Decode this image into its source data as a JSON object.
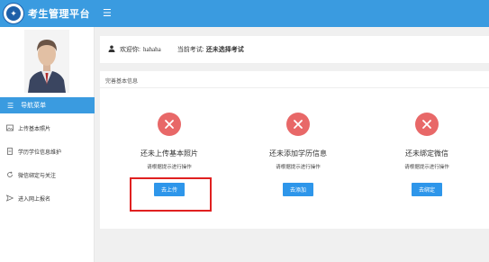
{
  "app": {
    "title": "考生管理平台",
    "logo_icon": "university-seal-icon"
  },
  "colors": {
    "primary": "#3a9be0",
    "button": "#2e96ea",
    "error": "#e86868",
    "highlight": "#e02020"
  },
  "sidebar": {
    "nav_header": "导航菜单",
    "items": [
      {
        "label": "上传基本照片",
        "icon": "image-icon"
      },
      {
        "label": "学历学位信息维护",
        "icon": "document-icon"
      },
      {
        "label": "微信绑定与关注",
        "icon": "refresh-icon"
      },
      {
        "label": "进入网上报名",
        "icon": "send-icon"
      }
    ]
  },
  "welcome": {
    "greeting_label": "欢迎你:",
    "username": "hahaha",
    "current_exam_label": "当前考试:",
    "current_exam_value": "还未选择考试"
  },
  "panel": {
    "title": "完善基本信息",
    "columns": [
      {
        "status": "还未上传基本照片",
        "hint": "请根据提示进行操作",
        "button": "去上传"
      },
      {
        "status": "还未添加学历信息",
        "hint": "请根据提示进行操作",
        "button": "去添加"
      },
      {
        "status": "还未绑定微信",
        "hint": "请根据提示进行操作",
        "button": "去绑定"
      }
    ]
  }
}
